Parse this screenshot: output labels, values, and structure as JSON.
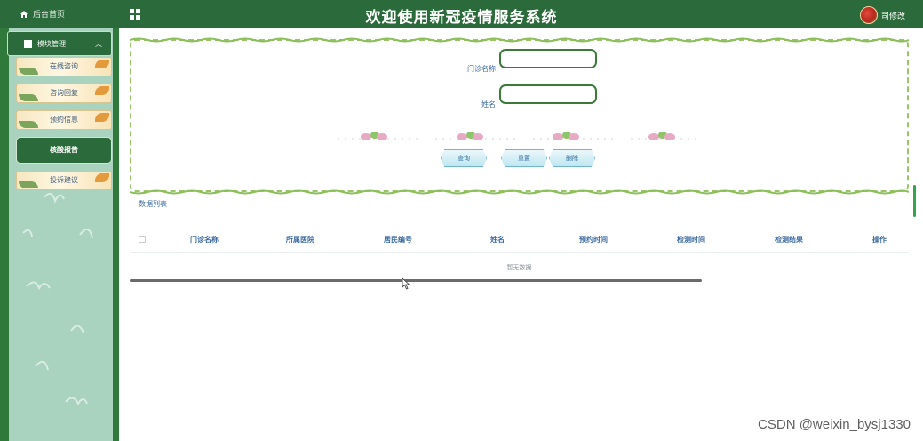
{
  "header": {
    "home_label": "后台首页",
    "title": "欢迎使用新冠疫情服务系统",
    "user_label": "司修改"
  },
  "sidebar": {
    "module_label": "模块管理",
    "items": [
      {
        "label": "在线咨询"
      },
      {
        "label": "咨询回复"
      },
      {
        "label": "预约信息"
      },
      {
        "label": "核酸报告"
      },
      {
        "label": "投诉建议"
      }
    ],
    "active_index": 3
  },
  "search": {
    "clinic_label": "门诊名称",
    "clinic_value": "",
    "name_label": "姓名",
    "name_value": "",
    "buttons": {
      "query": "查询",
      "reset": "重置",
      "delete": "删除"
    }
  },
  "list": {
    "label": "数据列表",
    "columns": [
      "门诊名称",
      "所属医院",
      "居民编号",
      "姓名",
      "预约时间",
      "检测时间",
      "检测结果",
      "操作"
    ],
    "empty_text": "暂无数据"
  },
  "watermark": "CSDN @weixin_bysj1330",
  "colors": {
    "topbar": "#2b6a3a",
    "sidebar": "#2f7a3a",
    "sidebar_bg": "#a9d2bf",
    "accent_blue": "#3c6aa0"
  }
}
